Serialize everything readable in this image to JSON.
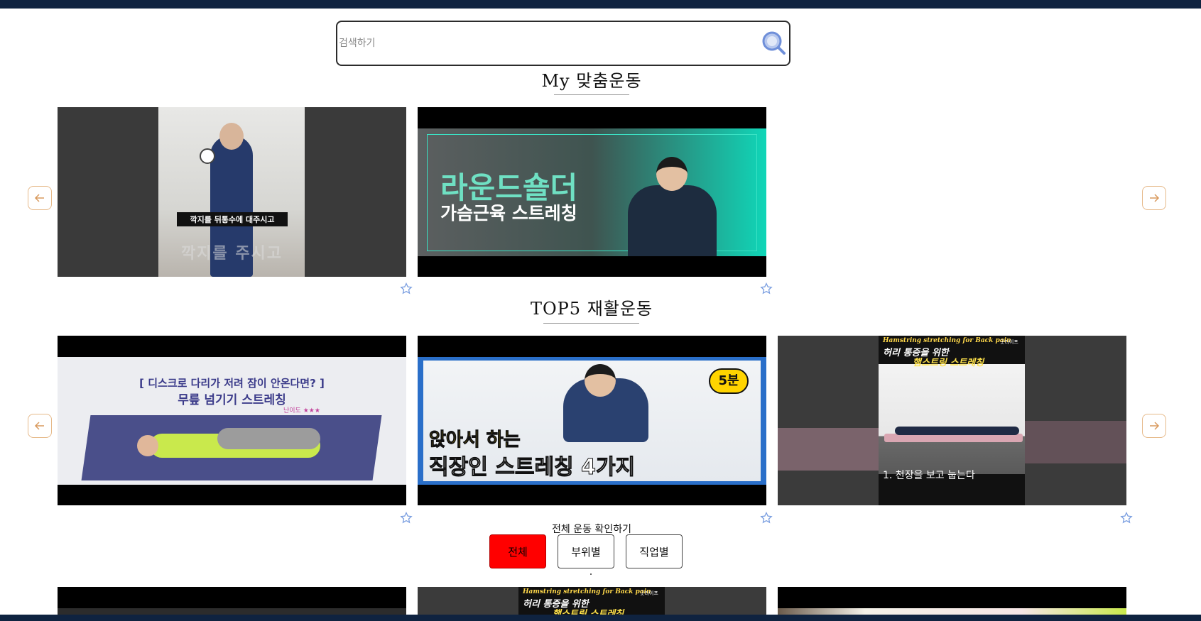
{
  "search": {
    "placeholder": "검색하기"
  },
  "sections": {
    "my_exercise": {
      "title": "My 맞춤운동"
    },
    "top5": {
      "title": "TOP5 재활운동"
    }
  },
  "my_cards": [
    {
      "overlay": "깍지를 뒤통수에 대주시고",
      "bg_text": "깍지를      주시고"
    },
    {
      "headline": "라운드숄더",
      "subline": "가슴근육 스트레칭"
    }
  ],
  "top5_cards": [
    {
      "headline": "[ 디스크로 다리가 저려 잠이 안온다면? ]",
      "subline": "무릎 넘기기 스트레칭",
      "badge": "난이도 ★★★"
    },
    {
      "headline": "앉아서 하는",
      "subline": "직장인 스트레칭 4가지",
      "badge": "5분"
    },
    {
      "top_en": "Hamstring stretching for Back pain",
      "headline": "허리 통증을 위한",
      "subline": "햄스트링 스트레칭",
      "caption": "1. 천장을 보고 눕는다",
      "brand": "굿라이프"
    }
  ],
  "bottom_cards": [
    {
      "top_en": "Hamstring stretching for Back pain",
      "headline": "허리 통증을 위한",
      "subline": "햄스트링 스트레칭",
      "brand": "굿라이프"
    }
  ],
  "filter": {
    "label": "전체 운동 확인하기",
    "tabs": [
      {
        "label": "전체",
        "active": true
      },
      {
        "label": "부위별",
        "active": false
      },
      {
        "label": "직업별",
        "active": false
      }
    ]
  },
  "colors": {
    "accent_red": "#ff0000",
    "nav_dark": "#0f2340",
    "arrow_border": "#e6b989",
    "star_blue": "#7a9ee0"
  },
  "icons": {
    "search": "search-icon",
    "prev": "arrow-left-icon",
    "next": "arrow-right-icon",
    "favorite": "star-icon"
  }
}
